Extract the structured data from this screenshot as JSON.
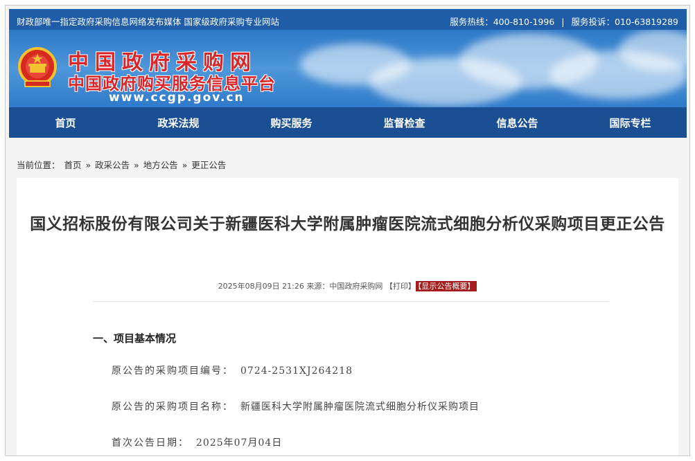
{
  "topbar": {
    "left_text": "财政部唯一指定政府采购信息网络发布媒体 国家级政府采购专业网站",
    "hotline": "服务热线：400-810-1996",
    "separator": "|",
    "complaint": "服务投诉：010-63819289"
  },
  "banner": {
    "logo_line1": "中国政府采购网",
    "logo_line2": "中国政府购买服务信息平台",
    "logo_url": "www.ccgp.gov.cn",
    "emblem_icon": "national-emblem-icon"
  },
  "nav": {
    "items": [
      "首页",
      "政采法规",
      "购买服务",
      "监督检查",
      "信息公告",
      "国际专栏"
    ]
  },
  "breadcrumb": {
    "prefix": "当前位置：",
    "items": [
      "首页",
      "政采公告",
      "地方公告",
      "更正公告"
    ],
    "sep": "»"
  },
  "article": {
    "title": "国义招标股份有限公司关于新疆医科大学附属肿瘤医院流式细胞分析仪采购项目更正公告",
    "date": "2025年08月09日 21:26",
    "source_label": "来源：",
    "source": "中国政府采购网",
    "print_label": "【打印】",
    "summary_label": "【显示公告概要】",
    "section1_heading": "一、项目基本情况",
    "fields": [
      {
        "label": "原公告的采购项目编号：",
        "value": "0724-2531XJ264218"
      },
      {
        "label": "原公告的采购项目名称：",
        "value": "新疆医科大学附属肿瘤医院流式细胞分析仪采购项目"
      },
      {
        "label": "首次公告日期：",
        "value": "2025年07月04日"
      }
    ]
  },
  "colors": {
    "topbar_bg": "#1f5da8",
    "nav_bg": "#1b4f94",
    "logo_red": "#d8262a",
    "summary_tag_bg": "#a51c1c"
  }
}
